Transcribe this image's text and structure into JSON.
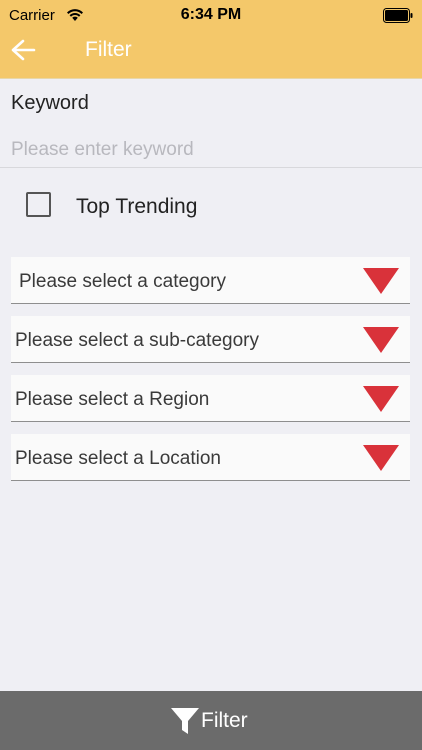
{
  "status_bar": {
    "carrier": "Carrier",
    "time": "6:34 PM",
    "icons": [
      "wifi-icon",
      "battery-icon"
    ]
  },
  "nav": {
    "title": "Filter",
    "back_icon": "arrow-left-icon",
    "background_color": "#f4c86a"
  },
  "keyword": {
    "label": "Keyword",
    "value": "",
    "placeholder": "Please enter keyword"
  },
  "top_trending": {
    "label": "Top Trending",
    "checked": false
  },
  "dropdowns": [
    {
      "label": "Please select a category"
    },
    {
      "label": "Please select a sub-category"
    },
    {
      "label": "Please select a Region"
    },
    {
      "label": "Please select a Location"
    }
  ],
  "dropdown_arrow_color": "#d9323a",
  "filter_button": {
    "label": "Filter",
    "icon": "funnel-icon",
    "background_color": "#6b6b6b"
  }
}
